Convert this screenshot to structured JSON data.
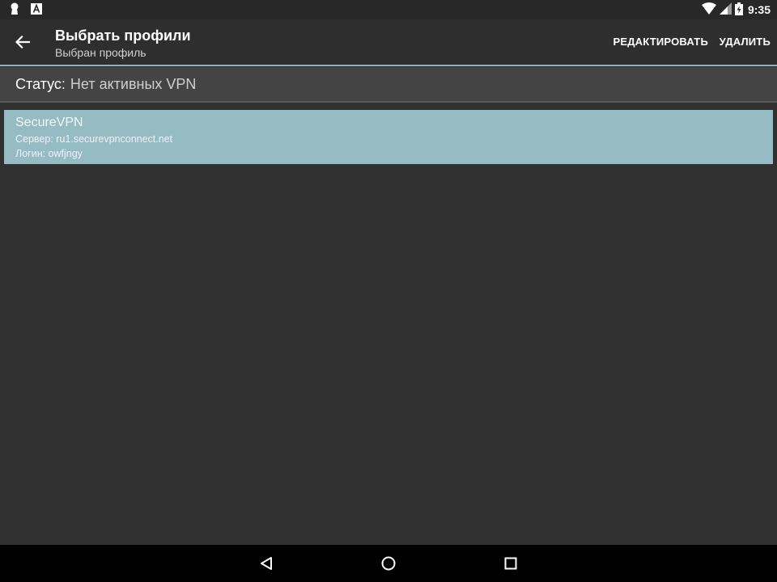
{
  "status_bar": {
    "time": "9:35",
    "icons": [
      "keyhole-icon",
      "a-box-icon",
      "wifi-icon",
      "signal-icon",
      "battery-charging-icon"
    ]
  },
  "app_bar": {
    "title": "Выбрать профили",
    "subtitle": "Выбран профиль",
    "actions": {
      "edit": "РЕДАКТИРОВАТЬ",
      "delete": "УДАЛИТЬ"
    },
    "accent_color": "#8fb4bc"
  },
  "vpn_status": {
    "label": "Статус:",
    "value": "Нет активных VPN"
  },
  "profiles": [
    {
      "name": "SecureVPN",
      "server": "Сервер: ru1.securevpnconnect.net",
      "login": "Логин: owfjngy",
      "selected": true,
      "highlight_color": "#95bcc2"
    }
  ],
  "nav_bar": {
    "buttons": [
      "back-triangle-icon",
      "home-circle-icon",
      "recents-square-icon"
    ]
  }
}
